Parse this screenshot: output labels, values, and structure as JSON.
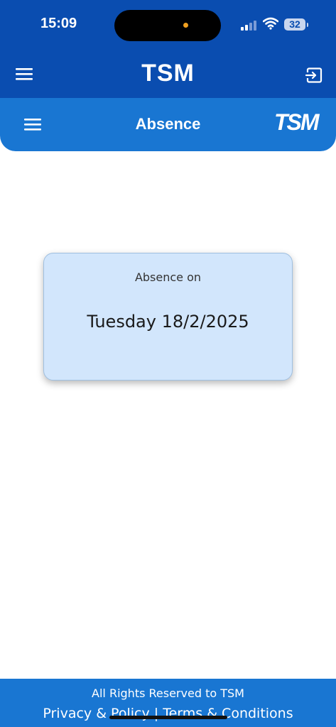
{
  "status_bar": {
    "time": "15:09",
    "battery": "32"
  },
  "app_bar": {
    "title": "TSM",
    "menu_icon": "hamburger-icon",
    "logout_icon": "logout-icon"
  },
  "sub_bar": {
    "title": "Absence",
    "logo": "TSM",
    "menu_icon": "hamburger-icon"
  },
  "card": {
    "label": "Absence on",
    "date": "Tuesday 18/2/2025"
  },
  "footer": {
    "rights": "All Rights Reserved to TSM",
    "privacy": "Privacy & Policy",
    "separator": "|",
    "terms": "Terms & Conditions"
  },
  "colors": {
    "primary_dark": "#0a4db0",
    "primary": "#1976d2",
    "card_bg": "#d2e6fc"
  }
}
